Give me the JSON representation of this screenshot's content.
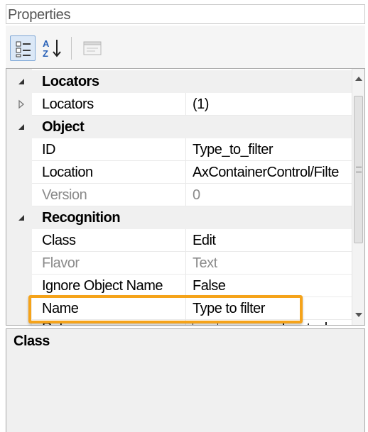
{
  "panel": {
    "title": "Properties"
  },
  "toolbar": {
    "categorized_icon": "categorized-view-icon",
    "alphabetical_icon": "sort-alphabetical-icon",
    "pages_icon": "property-pages-icon"
  },
  "grid": {
    "rows": [
      {
        "type": "category",
        "label": "Locators",
        "expanded": true
      },
      {
        "type": "property",
        "label": "Locators",
        "value": "(1)",
        "expandable": true
      },
      {
        "type": "category",
        "label": "Object",
        "expanded": true
      },
      {
        "type": "property",
        "label": "ID",
        "value": "Type_to_filter"
      },
      {
        "type": "property",
        "label": "Location",
        "value": "AxContainerControl/Filte"
      },
      {
        "type": "property",
        "label": "Version",
        "value": "0",
        "readonly": true
      },
      {
        "type": "category",
        "label": "Recognition",
        "expanded": true
      },
      {
        "type": "property",
        "label": "Class",
        "value": "Edit"
      },
      {
        "type": "property",
        "label": "Flavor",
        "value": "Text",
        "readonly": true
      },
      {
        "type": "property",
        "label": "Ignore Object Name",
        "value": "False"
      },
      {
        "type": "property",
        "label": "Name",
        "value": "Type to filter"
      },
      {
        "type": "property",
        "label": "Role",
        "value": "param:object_clas"
      }
    ]
  },
  "highlight_color": "#f5a31a",
  "description": {
    "title": "Class"
  }
}
